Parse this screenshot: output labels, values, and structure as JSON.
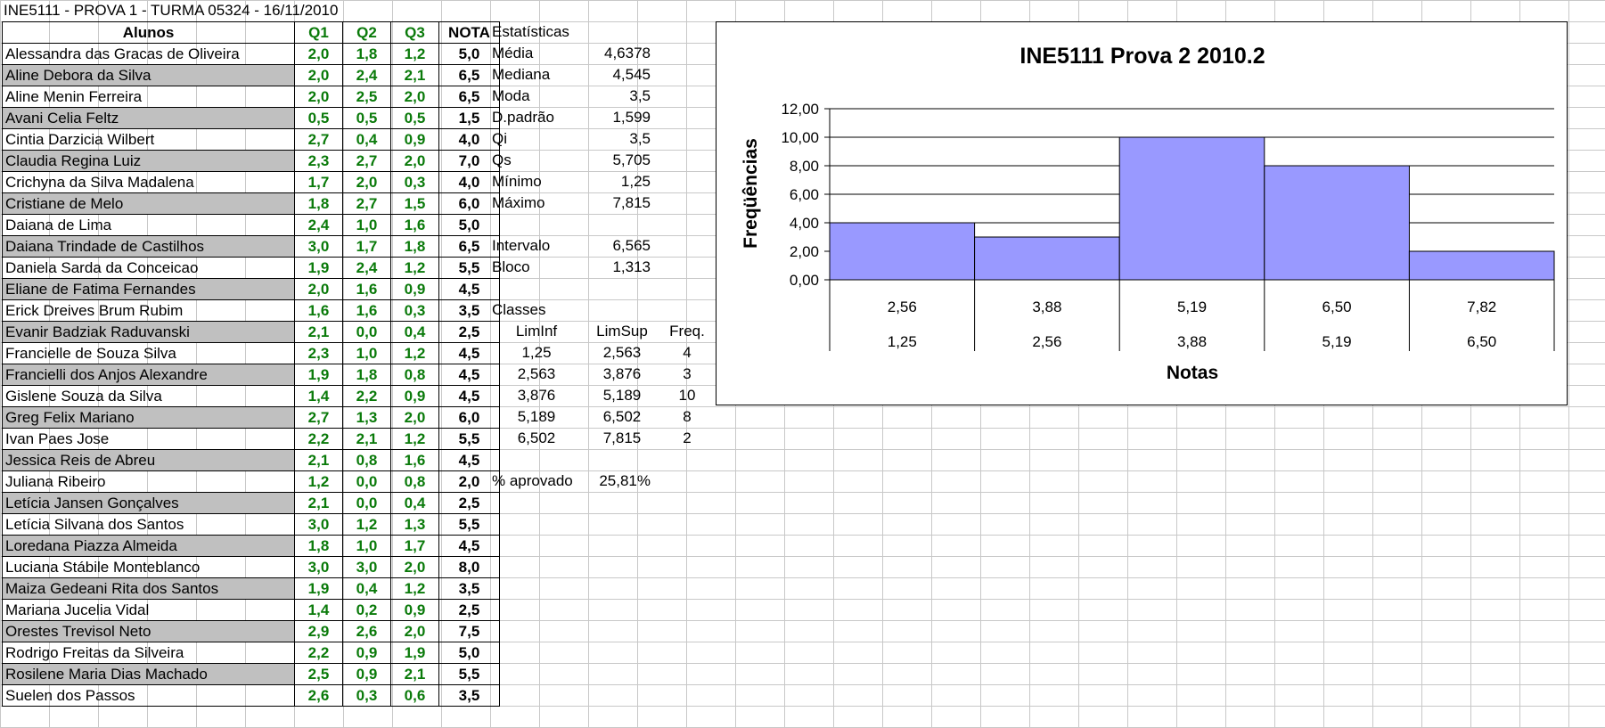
{
  "title": "INE5111 - PROVA 1 - TURMA 05324 - 16/11/2010",
  "table": {
    "headers": {
      "name": "Alunos",
      "q1": "Q1",
      "q2": "Q2",
      "q3": "Q3",
      "nota": "NOTA"
    },
    "rows": [
      {
        "name": "Alessandra das Gracas de Oliveira",
        "q1": "2,0",
        "q2": "1,8",
        "q3": "1,2",
        "nota": "5,0"
      },
      {
        "name": "Aline Debora da Silva",
        "q1": "2,0",
        "q2": "2,4",
        "q3": "2,1",
        "nota": "6,5"
      },
      {
        "name": "Aline Menin Ferreira",
        "q1": "2,0",
        "q2": "2,5",
        "q3": "2,0",
        "nota": "6,5"
      },
      {
        "name": "Avani Celia Feltz",
        "q1": "0,5",
        "q2": "0,5",
        "q3": "0,5",
        "nota": "1,5"
      },
      {
        "name": "Cintia Darzicia Wilbert",
        "q1": "2,7",
        "q2": "0,4",
        "q3": "0,9",
        "nota": "4,0"
      },
      {
        "name": "Claudia Regina Luiz",
        "q1": "2,3",
        "q2": "2,7",
        "q3": "2,0",
        "nota": "7,0"
      },
      {
        "name": "Crichyna da Silva Madalena",
        "q1": "1,7",
        "q2": "2,0",
        "q3": "0,3",
        "nota": "4,0"
      },
      {
        "name": "Cristiane de Melo",
        "q1": "1,8",
        "q2": "2,7",
        "q3": "1,5",
        "nota": "6,0"
      },
      {
        "name": "Daiana de Lima",
        "q1": "2,4",
        "q2": "1,0",
        "q3": "1,6",
        "nota": "5,0"
      },
      {
        "name": "Daiana Trindade de Castilhos",
        "q1": "3,0",
        "q2": "1,7",
        "q3": "1,8",
        "nota": "6,5"
      },
      {
        "name": "Daniela Sarda da Conceicao",
        "q1": "1,9",
        "q2": "2,4",
        "q3": "1,2",
        "nota": "5,5"
      },
      {
        "name": "Eliane de Fatima Fernandes",
        "q1": "2,0",
        "q2": "1,6",
        "q3": "0,9",
        "nota": "4,5"
      },
      {
        "name": "Erick Dreives Brum Rubim",
        "q1": "1,6",
        "q2": "1,6",
        "q3": "0,3",
        "nota": "3,5"
      },
      {
        "name": "Evanir Badziak Raduvanski",
        "q1": "2,1",
        "q2": "0,0",
        "q3": "0,4",
        "nota": "2,5"
      },
      {
        "name": "Francielle de Souza Silva",
        "q1": "2,3",
        "q2": "1,0",
        "q3": "1,2",
        "nota": "4,5"
      },
      {
        "name": "Francielli dos Anjos Alexandre",
        "q1": "1,9",
        "q2": "1,8",
        "q3": "0,8",
        "nota": "4,5"
      },
      {
        "name": "Gislene Souza da Silva",
        "q1": "1,4",
        "q2": "2,2",
        "q3": "0,9",
        "nota": "4,5"
      },
      {
        "name": "Greg Felix Mariano",
        "q1": "2,7",
        "q2": "1,3",
        "q3": "2,0",
        "nota": "6,0"
      },
      {
        "name": "Ivan Paes Jose",
        "q1": "2,2",
        "q2": "2,1",
        "q3": "1,2",
        "nota": "5,5"
      },
      {
        "name": "Jessica Reis de Abreu",
        "q1": "2,1",
        "q2": "0,8",
        "q3": "1,6",
        "nota": "4,5"
      },
      {
        "name": "Juliana Ribeiro",
        "q1": "1,2",
        "q2": "0,0",
        "q3": "0,8",
        "nota": "2,0"
      },
      {
        "name": "Letícia Jansen Gonçalves",
        "q1": "2,1",
        "q2": "0,0",
        "q3": "0,4",
        "nota": "2,5"
      },
      {
        "name": "Letícia Silvana dos Santos",
        "q1": "3,0",
        "q2": "1,2",
        "q3": "1,3",
        "nota": "5,5"
      },
      {
        "name": "Loredana Piazza Almeida",
        "q1": "1,8",
        "q2": "1,0",
        "q3": "1,7",
        "nota": "4,5"
      },
      {
        "name": "Luciana Stábile Monteblanco",
        "q1": "3,0",
        "q2": "3,0",
        "q3": "2,0",
        "nota": "8,0"
      },
      {
        "name": "Maiza Gedeani Rita dos Santos",
        "q1": "1,9",
        "q2": "0,4",
        "q3": "1,2",
        "nota": "3,5"
      },
      {
        "name": "Mariana Jucelia Vidal",
        "q1": "1,4",
        "q2": "0,2",
        "q3": "0,9",
        "nota": "2,5"
      },
      {
        "name": "Orestes Trevisol Neto",
        "q1": "2,9",
        "q2": "2,6",
        "q3": "2,0",
        "nota": "7,5"
      },
      {
        "name": "Rodrigo Freitas da Silveira",
        "q1": "2,2",
        "q2": "0,9",
        "q3": "1,9",
        "nota": "5,0"
      },
      {
        "name": "Rosilene Maria Dias Machado",
        "q1": "2,5",
        "q2": "0,9",
        "q3": "2,1",
        "nota": "5,5"
      },
      {
        "name": "Suelen dos Passos",
        "q1": "2,6",
        "q2": "0,3",
        "q3": "0,6",
        "nota": "3,5"
      }
    ]
  },
  "stats": {
    "header": "Estatísticas",
    "items": [
      {
        "label": "Média",
        "value": "4,6378"
      },
      {
        "label": "Mediana",
        "value": "4,545"
      },
      {
        "label": "Moda",
        "value": "3,5"
      },
      {
        "label": "D.padrão",
        "value": "1,599"
      },
      {
        "label": "Qi",
        "value": "3,5"
      },
      {
        "label": "Qs",
        "value": "5,705"
      },
      {
        "label": "Mínimo",
        "value": "1,25"
      },
      {
        "label": "Máximo",
        "value": "7,815"
      }
    ],
    "intervalo": {
      "label": "Intervalo",
      "value": "6,565"
    },
    "bloco": {
      "label": "Bloco",
      "value": "1,313"
    },
    "aprovado": {
      "label": "% aprovado",
      "value": "25,81%"
    }
  },
  "classes": {
    "header": "Classes",
    "cols": {
      "liminf": "LimInf",
      "limsup": "LimSup",
      "freq": "Freq."
    },
    "rows": [
      {
        "liminf": "1,25",
        "limsup": "2,563",
        "freq": "4"
      },
      {
        "liminf": "2,563",
        "limsup": "3,876",
        "freq": "3"
      },
      {
        "liminf": "3,876",
        "limsup": "5,189",
        "freq": "10"
      },
      {
        "liminf": "5,189",
        "limsup": "6,502",
        "freq": "8"
      },
      {
        "liminf": "6,502",
        "limsup": "7,815",
        "freq": "2"
      }
    ]
  },
  "chart_data": {
    "type": "bar",
    "title": "INE5111 Prova 2 2010.2",
    "xlabel": "Notas",
    "ylabel": "Freqüências",
    "categories_upper": [
      "2,56",
      "3,88",
      "5,19",
      "6,50",
      "7,82"
    ],
    "categories_lower": [
      "1,25",
      "2,56",
      "3,88",
      "5,19",
      "6,50"
    ],
    "values": [
      4,
      3,
      10,
      8,
      2
    ],
    "yticks": [
      "0,00",
      "2,00",
      "4,00",
      "6,00",
      "8,00",
      "10,00",
      "12,00"
    ],
    "ylim": [
      0,
      12
    ],
    "grid": true,
    "bar_color": "#9999ff"
  }
}
